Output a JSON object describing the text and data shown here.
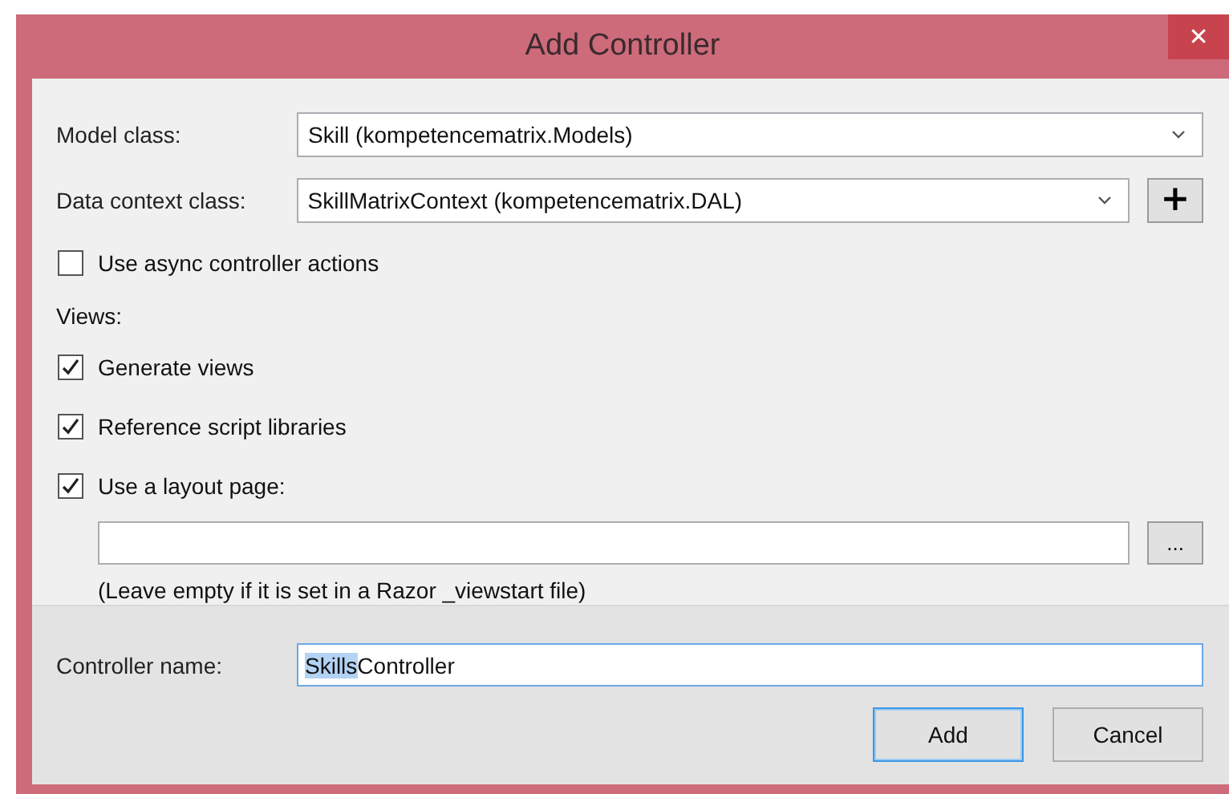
{
  "window": {
    "title": "Add Controller",
    "close": "✕"
  },
  "fields": [
    {
      "kind": "combo",
      "label": "Model class:",
      "value": "Skill (kompetencematrix.Models)"
    },
    {
      "kind": "combo",
      "label": "Data context class:",
      "value": "SkillMatrixContext (kompetencematrix.DAL)",
      "button": "+"
    }
  ],
  "async_option": {
    "label": "Use async controller actions",
    "checked": false
  },
  "views": {
    "label": "Views:",
    "options": [
      {
        "label": "Generate views",
        "checked": true
      },
      {
        "label": "Reference script libraries",
        "checked": true
      },
      {
        "label": "Use a layout page:",
        "checked": true
      }
    ],
    "layout_button": "...",
    "hint": "(Leave empty if it is set in a Razor _viewstart file)"
  },
  "controller_name": {
    "label": "Controller name:",
    "selected_part": "Skills",
    "rest": "Controller"
  },
  "buttons": [
    {
      "label": "Add",
      "default": true
    },
    {
      "label": "Cancel",
      "default": false
    }
  ]
}
